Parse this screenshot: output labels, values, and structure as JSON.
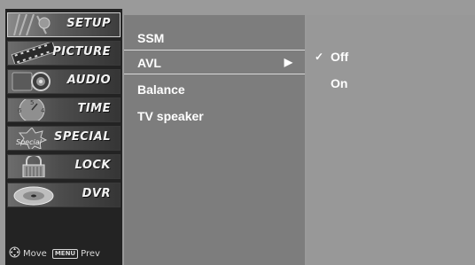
{
  "categories": [
    {
      "label": "SETUP",
      "icon": "gear-icon",
      "active": true
    },
    {
      "label": "PICTURE",
      "icon": "film-strip-icon",
      "active": false
    },
    {
      "label": "AUDIO",
      "icon": "speaker-icon",
      "active": false
    },
    {
      "label": "TIME",
      "icon": "clock-icon",
      "active": false
    },
    {
      "label": "SPECIAL",
      "icon": "special-badge-icon",
      "badge": "Special",
      "active": false
    },
    {
      "label": "LOCK",
      "icon": "lock-icon",
      "active": false
    },
    {
      "label": "DVR",
      "icon": "disc-icon",
      "active": false
    }
  ],
  "nav_hint": {
    "move_label": "Move",
    "menu_key": "MENU",
    "prev_label": "Prev"
  },
  "submenu": {
    "items": [
      {
        "label": "SSM"
      },
      {
        "label": "AVL",
        "selected": true,
        "arrow": "▶"
      },
      {
        "label": "Balance"
      },
      {
        "label": "TV speaker"
      }
    ]
  },
  "options": {
    "items": [
      {
        "label": "Off",
        "checked": true,
        "check_mark": "✓"
      },
      {
        "label": "On",
        "checked": false
      }
    ]
  },
  "colors": {
    "screen_bg": "#9a9a9a",
    "category_column": "#232323",
    "submenu_bg": "#7d7d7d",
    "options_bg": "#989898",
    "text": "#ffffff"
  }
}
